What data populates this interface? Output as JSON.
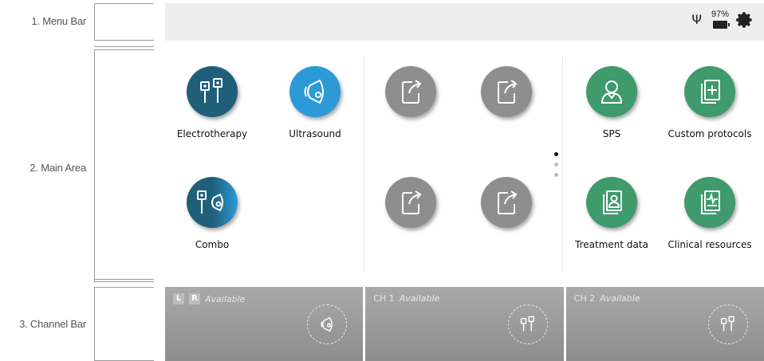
{
  "annotations": {
    "menu_bar": "1. Menu Bar",
    "main_area": "2. Main Area",
    "channel_bar": "3. Channel Bar"
  },
  "menubar": {
    "battery_percent": "97%",
    "icons": [
      "usb-icon",
      "battery-icon",
      "gear-icon"
    ]
  },
  "apps": {
    "electrotherapy": "Electrotherapy",
    "ultrasound": "Ultrasound",
    "combo": "Combo",
    "sps": "SPS",
    "custom_protocols": "Custom protocols",
    "treatment_data": "Treatment data",
    "clinical_resources": "Clinical resources"
  },
  "shortcut_slots": [
    "shortcut-icon",
    "shortcut-icon",
    "shortcut-icon",
    "shortcut-icon"
  ],
  "pager": {
    "pages": 3,
    "active": 1
  },
  "channels": [
    {
      "prefix_l": "L",
      "prefix_r": "R",
      "status": "Available",
      "icon": "ultrasound-icon"
    },
    {
      "name": "CH 1",
      "status": "Available",
      "icon": "electrotherapy-icon"
    },
    {
      "name": "CH 2",
      "status": "Available",
      "icon": "electrotherapy-icon"
    }
  ],
  "colors": {
    "electrotherapy": "#1f5f7a",
    "ultrasound": "#2b9ad6",
    "shortcut": "#8e8e8e",
    "green": "#3f9a6c",
    "menubar": "#eeeeee",
    "channelbar": "#9b9b9b"
  }
}
